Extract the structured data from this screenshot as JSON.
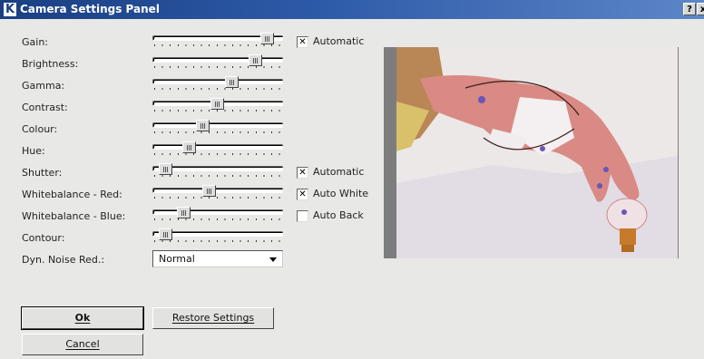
{
  "window": {
    "app_icon_letter": "K",
    "title": "Camera Settings Panel",
    "help_button": "?",
    "close_button": "x"
  },
  "controls": [
    {
      "label": "Gain:",
      "level": 0.92
    },
    {
      "label": "Brightness:",
      "level": 0.82
    },
    {
      "label": "Gamma:",
      "level": 0.62
    },
    {
      "label": "Contrast:",
      "level": 0.49
    },
    {
      "label": "Colour:",
      "level": 0.37
    },
    {
      "label": "Hue:",
      "level": 0.25
    },
    {
      "label": "Shutter:",
      "level": 0.05
    },
    {
      "label": "Whitebalance - Red:",
      "level": 0.42
    },
    {
      "label": "Whitebalance - Blue:",
      "level": 0.2
    },
    {
      "label": "Contour:",
      "level": 0.05
    }
  ],
  "checkboxes": {
    "gain_auto": {
      "label": "Automatic",
      "checked": true
    },
    "shutter_auto": {
      "label": "Automatic",
      "checked": true
    },
    "auto_white": {
      "label": "Auto White",
      "checked": true
    },
    "auto_back": {
      "label": "Auto Back",
      "checked": false
    }
  },
  "noise": {
    "label": "Dyn. Noise Red.:",
    "value": "Normal"
  },
  "buttons": {
    "ok": "Ok",
    "restore": "Restore Settings",
    "cancel": "Cancel"
  },
  "preview": {
    "icon": "camera-feed-hand-with-lightbulb"
  },
  "colors": {
    "titlebar": "#1a3f82",
    "background": "#e8e8e6"
  }
}
